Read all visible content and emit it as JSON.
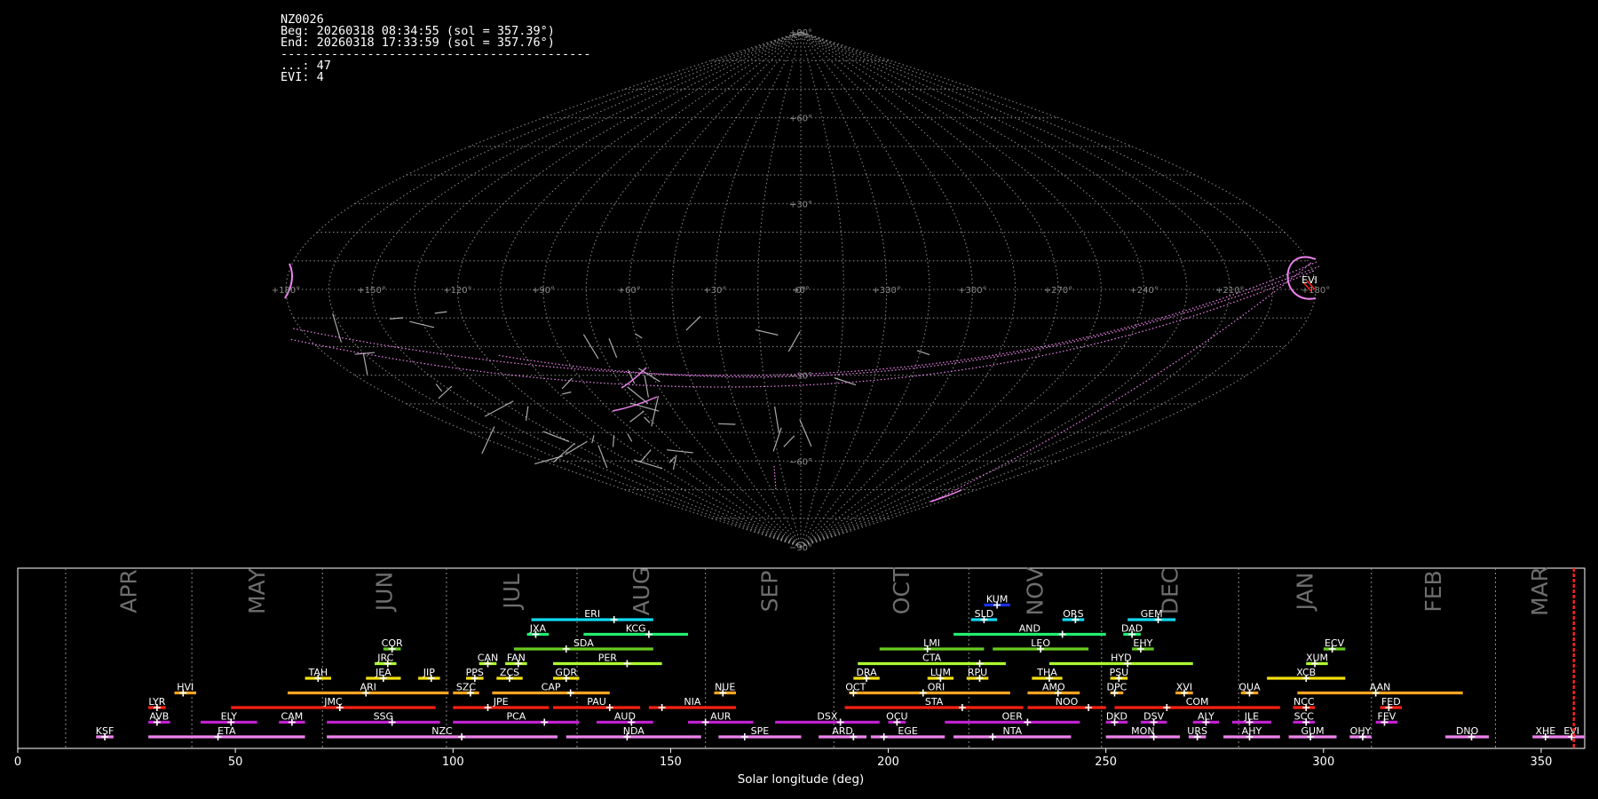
{
  "header": {
    "station": "NZ0026",
    "beg": "Beg: 20260318 08:34:55 (sol = 357.39°)",
    "end": "End: 20260318 17:33:59 (sol = 357.76°)",
    "separator": "-------------------------------------------",
    "count_sporadic": "...: 47",
    "count_evi": "EVI: 4"
  },
  "sky_map": {
    "lat_labels": [
      "+90°",
      "+60°",
      "+30°",
      "0°",
      "−30°",
      "−60°",
      "−90°"
    ],
    "lon_labels": [
      "+180°",
      "+150°",
      "+120°",
      "+90°",
      "+60°",
      "+30°",
      "+0°",
      "+330°",
      "+300°",
      "+270°",
      "+240°",
      "+210°",
      "+180°"
    ],
    "shower_label": "EVI",
    "colors": {
      "grid": "#9a9a9a",
      "sporadic": "#c8c8c8",
      "evi": "#ee82ee",
      "radiant": "#ff2020"
    }
  },
  "chart_data": {
    "type": "timeline",
    "xlabel": "Solar longitude (deg)",
    "xlim": [
      0,
      360
    ],
    "xticks": [
      0,
      50,
      100,
      150,
      200,
      250,
      300,
      350
    ],
    "current_sol": 357.5,
    "months": [
      {
        "name": "APR",
        "start": 11.0,
        "end": 40.0
      },
      {
        "name": "MAY",
        "start": 40.0,
        "end": 70.0
      },
      {
        "name": "JUN",
        "start": 70.0,
        "end": 98.5
      },
      {
        "name": "JUL",
        "start": 98.5,
        "end": 128.5
      },
      {
        "name": "AUG",
        "start": 128.5,
        "end": 158.0
      },
      {
        "name": "SEP",
        "start": 158.0,
        "end": 187.5
      },
      {
        "name": "OCT",
        "start": 187.5,
        "end": 218.5
      },
      {
        "name": "NOV",
        "start": 218.5,
        "end": 249.0
      },
      {
        "name": "DEC",
        "start": 249.0,
        "end": 280.5
      },
      {
        "name": "JAN",
        "start": 280.5,
        "end": 311.0
      },
      {
        "name": "FEB",
        "start": 311.0,
        "end": 339.5
      },
      {
        "name": "MAR",
        "start": 339.5,
        "end": 360.0
      }
    ],
    "showers": [
      {
        "code": "KSF",
        "row": 0,
        "start": 18,
        "end": 22,
        "peak": 20,
        "color": "#ee82ee"
      },
      {
        "code": "ETA",
        "row": 0,
        "start": 30,
        "end": 66,
        "peak": 46,
        "color": "#ee82ee"
      },
      {
        "code": "NZC",
        "row": 0,
        "start": 71,
        "end": 124,
        "peak": 102,
        "color": "#ee82ee"
      },
      {
        "code": "NDA",
        "row": 0,
        "start": 126,
        "end": 157,
        "peak": 140,
        "color": "#ee82ee"
      },
      {
        "code": "SPE",
        "row": 0,
        "start": 161,
        "end": 180,
        "peak": 167,
        "color": "#ee82ee"
      },
      {
        "code": "ARD",
        "row": 0,
        "start": 184,
        "end": 195,
        "peak": 192,
        "color": "#ee82ee"
      },
      {
        "code": "EGE",
        "row": 0,
        "start": 196,
        "end": 213,
        "peak": 199,
        "color": "#ee82ee"
      },
      {
        "code": "NTA",
        "row": 0,
        "start": 215,
        "end": 242,
        "peak": 224,
        "color": "#ee82ee"
      },
      {
        "code": "MON",
        "row": 0,
        "start": 250,
        "end": 267,
        "peak": 261,
        "color": "#ee82ee"
      },
      {
        "code": "URS",
        "row": 0,
        "start": 269,
        "end": 273,
        "peak": 271,
        "color": "#ee82ee"
      },
      {
        "code": "AHY",
        "row": 0,
        "start": 277,
        "end": 290,
        "peak": 283,
        "color": "#ee82ee"
      },
      {
        "code": "GUM",
        "row": 0,
        "start": 292,
        "end": 303,
        "peak": 297,
        "color": "#ee82ee"
      },
      {
        "code": "OHY",
        "row": 0,
        "start": 306,
        "end": 311,
        "peak": 309,
        "color": "#ee82ee"
      },
      {
        "code": "DNO",
        "row": 0,
        "start": 328,
        "end": 338,
        "peak": 334,
        "color": "#ee82ee"
      },
      {
        "code": "XHE",
        "row": 0,
        "start": 348,
        "end": 354,
        "peak": 351,
        "color": "#ee82ee"
      },
      {
        "code": "EVI",
        "row": 0,
        "start": 354,
        "end": 360,
        "peak": 357,
        "color": "#ee82ee"
      },
      {
        "code": "AVB",
        "row": 1,
        "start": 30,
        "end": 35,
        "peak": 32,
        "color": "#c020d0"
      },
      {
        "code": "ELY",
        "row": 1,
        "start": 42,
        "end": 55,
        "peak": 49,
        "color": "#c020d0"
      },
      {
        "code": "CAM",
        "row": 1,
        "start": 60,
        "end": 66,
        "peak": 63,
        "color": "#c020d0"
      },
      {
        "code": "SSG",
        "row": 1,
        "start": 71,
        "end": 97,
        "peak": 86,
        "color": "#c020d0"
      },
      {
        "code": "PCA",
        "row": 1,
        "start": 100,
        "end": 129,
        "peak": 121,
        "color": "#c020d0"
      },
      {
        "code": "AUD",
        "row": 1,
        "start": 133,
        "end": 146,
        "peak": 141,
        "color": "#c020d0"
      },
      {
        "code": "AUR",
        "row": 1,
        "start": 154,
        "end": 169,
        "peak": 158,
        "color": "#c020d0"
      },
      {
        "code": "DSX",
        "row": 1,
        "start": 174,
        "end": 198,
        "peak": 189,
        "color": "#c020d0"
      },
      {
        "code": "OCU",
        "row": 1,
        "start": 200,
        "end": 204,
        "peak": 202,
        "color": "#c020d0"
      },
      {
        "code": "OER",
        "row": 1,
        "start": 213,
        "end": 244,
        "peak": 232,
        "color": "#c020d0"
      },
      {
        "code": "DKD",
        "row": 1,
        "start": 250,
        "end": 255,
        "peak": 252,
        "color": "#c020d0"
      },
      {
        "code": "DSV",
        "row": 1,
        "start": 258,
        "end": 264,
        "peak": 261,
        "color": "#c020d0"
      },
      {
        "code": "ALY",
        "row": 1,
        "start": 270,
        "end": 276,
        "peak": 273,
        "color": "#c020d0"
      },
      {
        "code": "JLE",
        "row": 1,
        "start": 279,
        "end": 288,
        "peak": 283,
        "color": "#c020d0"
      },
      {
        "code": "SCC",
        "row": 1,
        "start": 293,
        "end": 298,
        "peak": 296,
        "color": "#c020d0"
      },
      {
        "code": "FEV",
        "row": 1,
        "start": 312,
        "end": 317,
        "peak": 314,
        "color": "#c020d0"
      },
      {
        "code": "LYR",
        "row": 2,
        "start": 30,
        "end": 34,
        "peak": 32,
        "color": "#ff2010"
      },
      {
        "code": "JMC",
        "row": 2,
        "start": 49,
        "end": 96,
        "peak": 74,
        "color": "#ff2010"
      },
      {
        "code": "JPE",
        "row": 2,
        "start": 100,
        "end": 122,
        "peak": 108,
        "color": "#ff2010"
      },
      {
        "code": "PAU",
        "row": 2,
        "start": 123,
        "end": 143,
        "peak": 136,
        "color": "#ff2010"
      },
      {
        "code": "NIA",
        "row": 2,
        "start": 145,
        "end": 165,
        "peak": 148,
        "color": "#ff2010"
      },
      {
        "code": "STA",
        "row": 2,
        "start": 190,
        "end": 231,
        "peak": 217,
        "color": "#ff2010"
      },
      {
        "code": "NOO",
        "row": 2,
        "start": 232,
        "end": 250,
        "peak": 246,
        "color": "#ff2010"
      },
      {
        "code": "COM",
        "row": 2,
        "start": 252,
        "end": 290,
        "peak": 264,
        "color": "#ff2010"
      },
      {
        "code": "NCC",
        "row": 2,
        "start": 293,
        "end": 298,
        "peak": 296,
        "color": "#ff2010"
      },
      {
        "code": "FED",
        "row": 2,
        "start": 313,
        "end": 318,
        "peak": 315,
        "color": "#ff2010"
      },
      {
        "code": "HVI",
        "row": 3,
        "start": 36,
        "end": 41,
        "peak": 38,
        "color": "#ffa520"
      },
      {
        "code": "ARI",
        "row": 3,
        "start": 62,
        "end": 99,
        "peak": 80,
        "color": "#ffa520"
      },
      {
        "code": "SZC",
        "row": 3,
        "start": 100,
        "end": 106,
        "peak": 104,
        "color": "#ffa520"
      },
      {
        "code": "CAP",
        "row": 3,
        "start": 109,
        "end": 136,
        "peak": 127,
        "color": "#ffa520"
      },
      {
        "code": "NUE",
        "row": 3,
        "start": 160,
        "end": 165,
        "peak": 162,
        "color": "#ffa520"
      },
      {
        "code": "OCT",
        "row": 3,
        "start": 191,
        "end": 194,
        "peak": 192,
        "color": "#ffa520"
      },
      {
        "code": "ORI",
        "row": 3,
        "start": 194,
        "end": 228,
        "peak": 208,
        "color": "#ffa520"
      },
      {
        "code": "AMO",
        "row": 3,
        "start": 232,
        "end": 244,
        "peak": 239,
        "color": "#ffa520"
      },
      {
        "code": "DPC",
        "row": 3,
        "start": 251,
        "end": 254,
        "peak": 252,
        "color": "#ffa520"
      },
      {
        "code": "XVI",
        "row": 3,
        "start": 266,
        "end": 270,
        "peak": 268,
        "color": "#ffa520"
      },
      {
        "code": "QUA",
        "row": 3,
        "start": 281,
        "end": 285,
        "peak": 283,
        "color": "#ffa520"
      },
      {
        "code": "AAN",
        "row": 3,
        "start": 294,
        "end": 332,
        "peak": 312,
        "color": "#ffa520"
      },
      {
        "code": "TAH",
        "row": 4,
        "start": 66,
        "end": 72,
        "peak": 69,
        "color": "#f5e010"
      },
      {
        "code": "JEA",
        "row": 4,
        "start": 80,
        "end": 88,
        "peak": 84,
        "color": "#f5e010"
      },
      {
        "code": "JIP",
        "row": 4,
        "start": 92,
        "end": 97,
        "peak": 95,
        "color": "#f5e010"
      },
      {
        "code": "PPS",
        "row": 4,
        "start": 103,
        "end": 107,
        "peak": 105,
        "color": "#f5e010"
      },
      {
        "code": "ZCS",
        "row": 4,
        "start": 110,
        "end": 116,
        "peak": 113,
        "color": "#f5e010"
      },
      {
        "code": "GDR",
        "row": 4,
        "start": 123,
        "end": 129,
        "peak": 126,
        "color": "#f5e010"
      },
      {
        "code": "DRA",
        "row": 4,
        "start": 192,
        "end": 198,
        "peak": 195,
        "color": "#f5e010"
      },
      {
        "code": "LUM",
        "row": 4,
        "start": 209,
        "end": 215,
        "peak": 212,
        "color": "#f5e010"
      },
      {
        "code": "RPU",
        "row": 4,
        "start": 218,
        "end": 223,
        "peak": 221,
        "color": "#f5e010"
      },
      {
        "code": "THA",
        "row": 4,
        "start": 233,
        "end": 240,
        "peak": 237,
        "color": "#f5e010"
      },
      {
        "code": "PSU",
        "row": 4,
        "start": 251,
        "end": 255,
        "peak": 253,
        "color": "#f5e010"
      },
      {
        "code": "XCB",
        "row": 4,
        "start": 287,
        "end": 305,
        "peak": 296,
        "color": "#f5e010"
      },
      {
        "code": "JRC",
        "row": 5,
        "start": 82,
        "end": 87,
        "peak": 85,
        "color": "#adff2f"
      },
      {
        "code": "CAN",
        "row": 5,
        "start": 106,
        "end": 110,
        "peak": 108,
        "color": "#adff2f"
      },
      {
        "code": "FAN",
        "row": 5,
        "start": 112,
        "end": 117,
        "peak": 115,
        "color": "#adff2f"
      },
      {
        "code": "PER",
        "row": 5,
        "start": 123,
        "end": 148,
        "peak": 140,
        "color": "#adff2f"
      },
      {
        "code": "CTA",
        "row": 5,
        "start": 193,
        "end": 227,
        "peak": 221,
        "color": "#adff2f"
      },
      {
        "code": "HYD",
        "row": 5,
        "start": 237,
        "end": 270,
        "peak": 255,
        "color": "#adff2f"
      },
      {
        "code": "XUM",
        "row": 5,
        "start": 296,
        "end": 301,
        "peak": 298,
        "color": "#adff2f"
      },
      {
        "code": "COR",
        "row": 6,
        "start": 84,
        "end": 88,
        "peak": 86,
        "color": "#66cc22"
      },
      {
        "code": "SDA",
        "row": 6,
        "start": 114,
        "end": 146,
        "peak": 126,
        "color": "#66cc22"
      },
      {
        "code": "LMI",
        "row": 6,
        "start": 198,
        "end": 222,
        "peak": 209,
        "color": "#66cc22"
      },
      {
        "code": "LEO",
        "row": 6,
        "start": 224,
        "end": 246,
        "peak": 235,
        "color": "#66cc22"
      },
      {
        "code": "EHY",
        "row": 6,
        "start": 256,
        "end": 261,
        "peak": 258,
        "color": "#66cc22"
      },
      {
        "code": "ECV",
        "row": 6,
        "start": 300,
        "end": 305,
        "peak": 302,
        "color": "#66cc22"
      },
      {
        "code": "JXA",
        "row": 7,
        "start": 117,
        "end": 122,
        "peak": 119,
        "color": "#20ee70"
      },
      {
        "code": "KCG",
        "row": 7,
        "start": 130,
        "end": 154,
        "peak": 145,
        "color": "#20ee70"
      },
      {
        "code": "AND",
        "row": 7,
        "start": 215,
        "end": 250,
        "peak": 240,
        "color": "#20ee70"
      },
      {
        "code": "DAD",
        "row": 7,
        "start": 254,
        "end": 258,
        "peak": 256,
        "color": "#20ee70"
      },
      {
        "code": "ERI",
        "row": 8,
        "start": 118,
        "end": 146,
        "peak": 137,
        "color": "#10d8f0"
      },
      {
        "code": "SLD",
        "row": 8,
        "start": 219,
        "end": 225,
        "peak": 222,
        "color": "#10d8f0"
      },
      {
        "code": "ORS",
        "row": 8,
        "start": 240,
        "end": 245,
        "peak": 243,
        "color": "#10d8f0"
      },
      {
        "code": "GEM",
        "row": 8,
        "start": 255,
        "end": 266,
        "peak": 262,
        "color": "#10d8f0"
      },
      {
        "code": "KUM",
        "row": 9,
        "start": 222,
        "end": 228,
        "peak": 225,
        "color": "#1a30e0"
      }
    ]
  }
}
